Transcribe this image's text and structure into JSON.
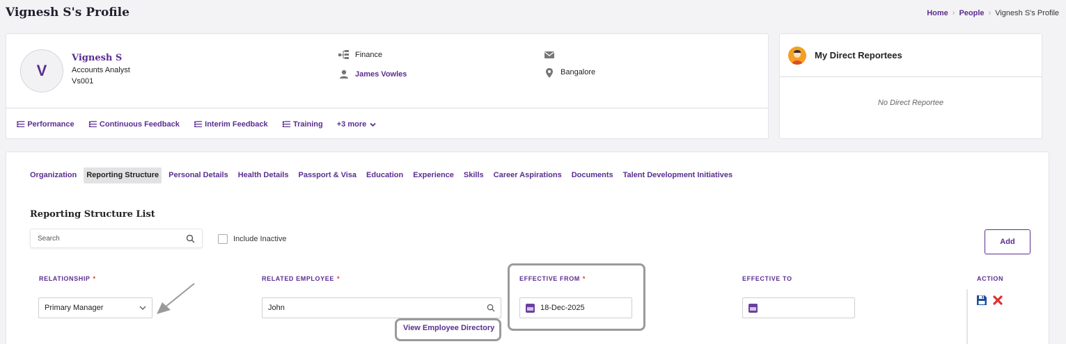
{
  "header": {
    "title": "Vignesh S's Profile",
    "breadcrumb": [
      "Home",
      "People",
      "Vignesh S's Profile"
    ]
  },
  "profile": {
    "avatar_initial": "V",
    "name": "Vignesh S",
    "designation": "Accounts Analyst",
    "code": "Vs001",
    "department": "Finance",
    "manager": "James Vowles",
    "email": "",
    "location": "Bangalore",
    "quick_links": [
      "Performance",
      "Continuous Feedback",
      "Interim Feedback",
      "Training"
    ],
    "more_label": "+3 more"
  },
  "reportees": {
    "title": "My Direct Reportees",
    "empty_text": "No Direct Reportee"
  },
  "tabs": [
    "Organization",
    "Reporting Structure",
    "Personal Details",
    "Health Details",
    "Passport & Visa",
    "Education",
    "Experience",
    "Skills",
    "Career Aspirations",
    "Documents",
    "Talent Development Initiatives"
  ],
  "active_tab": "Reporting Structure",
  "list": {
    "title": "Reporting Structure List",
    "search_placeholder": "Search",
    "include_inactive_label": "Include Inactive",
    "add_label": "Add"
  },
  "columns": {
    "relationship": "RELATIONSHIP",
    "related_employee": "RELATED EMPLOYEE",
    "effective_from": "EFFECTIVE FROM",
    "effective_to": "EFFECTIVE TO",
    "action": "ACTION",
    "required_mark": "*"
  },
  "row": {
    "relationship": "Primary Manager",
    "related_employee": "John",
    "view_directory": "View Employee Directory",
    "effective_from": "18-Dec-2025",
    "effective_to": ""
  },
  "colors": {
    "accent": "#5b2d90",
    "danger": "#e03030"
  }
}
